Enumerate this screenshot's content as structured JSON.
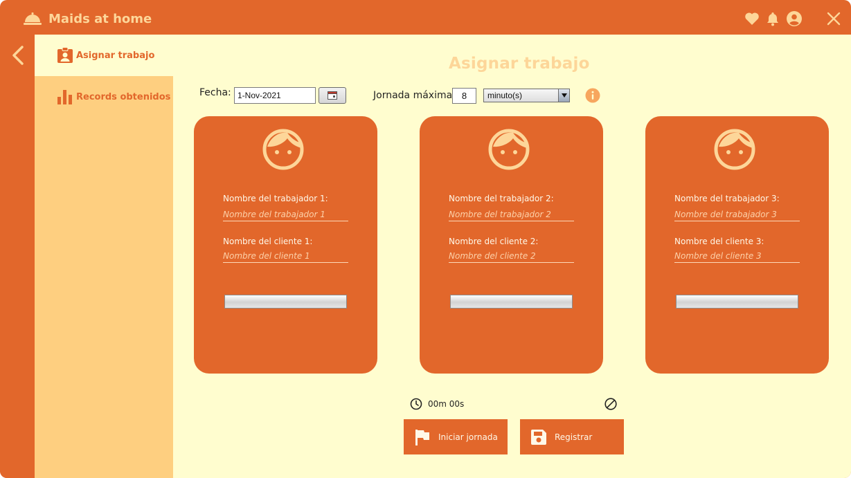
{
  "app": {
    "title": "Maids at home"
  },
  "titlebar": {
    "icons": [
      "heart-icon",
      "bell-icon",
      "user-account-icon",
      "close-icon"
    ]
  },
  "sidebar": {
    "items": [
      {
        "label": "Asignar trabajo",
        "icon": "clipboard-user-icon",
        "active": true
      },
      {
        "label": "Records obtenidos",
        "icon": "bar-chart-icon",
        "active": false
      }
    ]
  },
  "page": {
    "title": "Asignar trabajo"
  },
  "form": {
    "fecha_label": "Fecha:",
    "fecha_value": "1-Nov-2021",
    "jornada_label": "Jornada máxima:",
    "jornada_value": "8",
    "unit_value": "minuto(s)"
  },
  "workers": [
    {
      "worker_label": "Nombre del trabajador 1:",
      "worker_placeholder": "Nombre del trabajador 1",
      "client_label": "Nombre del cliente 1:",
      "client_placeholder": "Nombre del cliente 1"
    },
    {
      "worker_label": "Nombre del trabajador 2:",
      "worker_placeholder": "Nombre del trabajador 2",
      "client_label": "Nombre del cliente 2:",
      "client_placeholder": "Nombre del cliente 2"
    },
    {
      "worker_label": "Nombre del trabajador 3:",
      "worker_placeholder": "Nombre del trabajador 3",
      "client_label": "Nombre del cliente 3:",
      "client_placeholder": "Nombre del cliente 3"
    }
  ],
  "timer": {
    "text": "00m 00s"
  },
  "actions": {
    "start_label": "Iniciar jornada",
    "save_label": "Registrar"
  },
  "colors": {
    "accent": "#e2672b",
    "background": "#fffdcf",
    "sidebar": "#fecf80",
    "title": "#fdd699"
  }
}
